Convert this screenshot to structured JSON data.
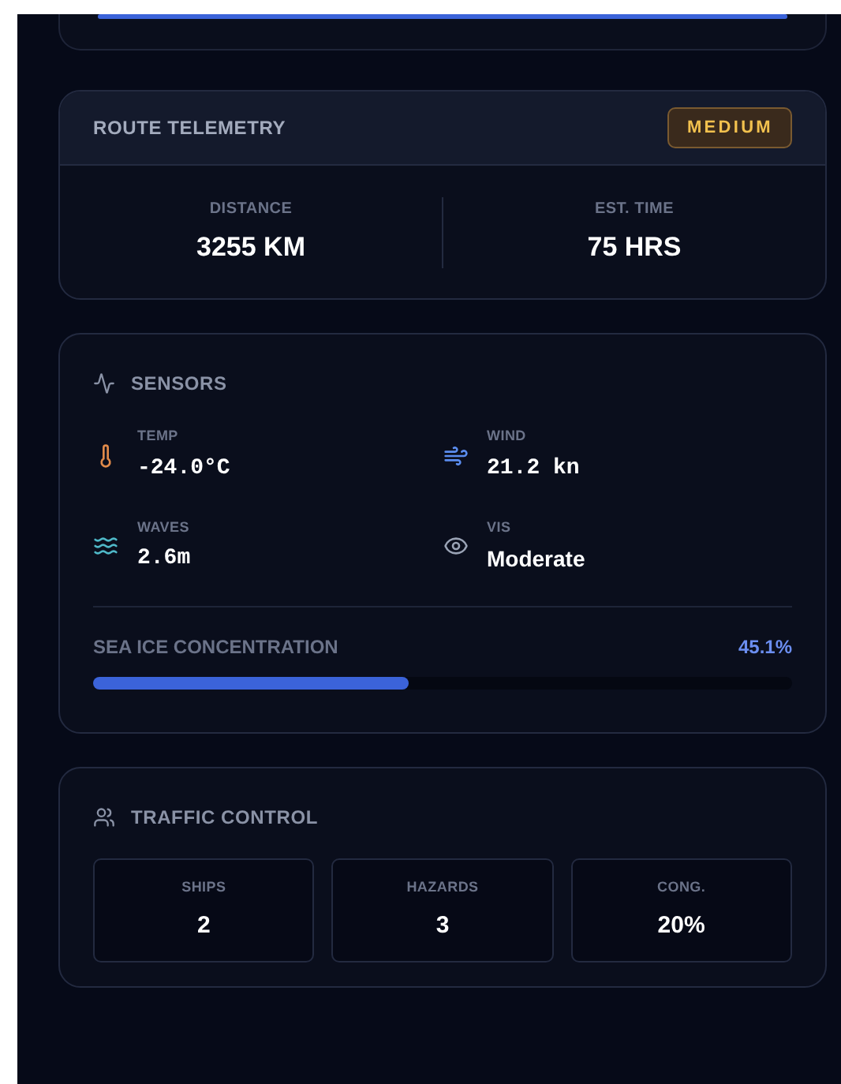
{
  "top_panel": {
    "level": 1
  },
  "route_telemetry": {
    "title": "ROUTE TELEMETRY",
    "badge": "MEDIUM",
    "stats": [
      {
        "label": "DISTANCE",
        "value": "3255 KM"
      },
      {
        "label": "EST. TIME",
        "value": "75 HRS"
      }
    ]
  },
  "sensors": {
    "title": "SENSORS",
    "items": [
      {
        "label": "TEMP",
        "value": "-24.0°C",
        "kind": "reading"
      },
      {
        "label": "WIND",
        "value": "21.2 kn",
        "kind": "reading"
      },
      {
        "label": "WAVES",
        "value": "2.6m",
        "kind": "reading"
      },
      {
        "label": "VIS",
        "value": "Moderate",
        "kind": "text"
      }
    ],
    "sea_ice": {
      "label": "SEA ICE CONCENTRATION",
      "reading": "45.1%",
      "level": 0.451
    }
  },
  "traffic_control": {
    "title": "TRAFFIC CONTROL",
    "stats": [
      {
        "label": "SHIPS",
        "value": "2"
      },
      {
        "label": "HAZARDS",
        "value": "3"
      },
      {
        "label": "CONG.",
        "value": "20%"
      }
    ]
  }
}
